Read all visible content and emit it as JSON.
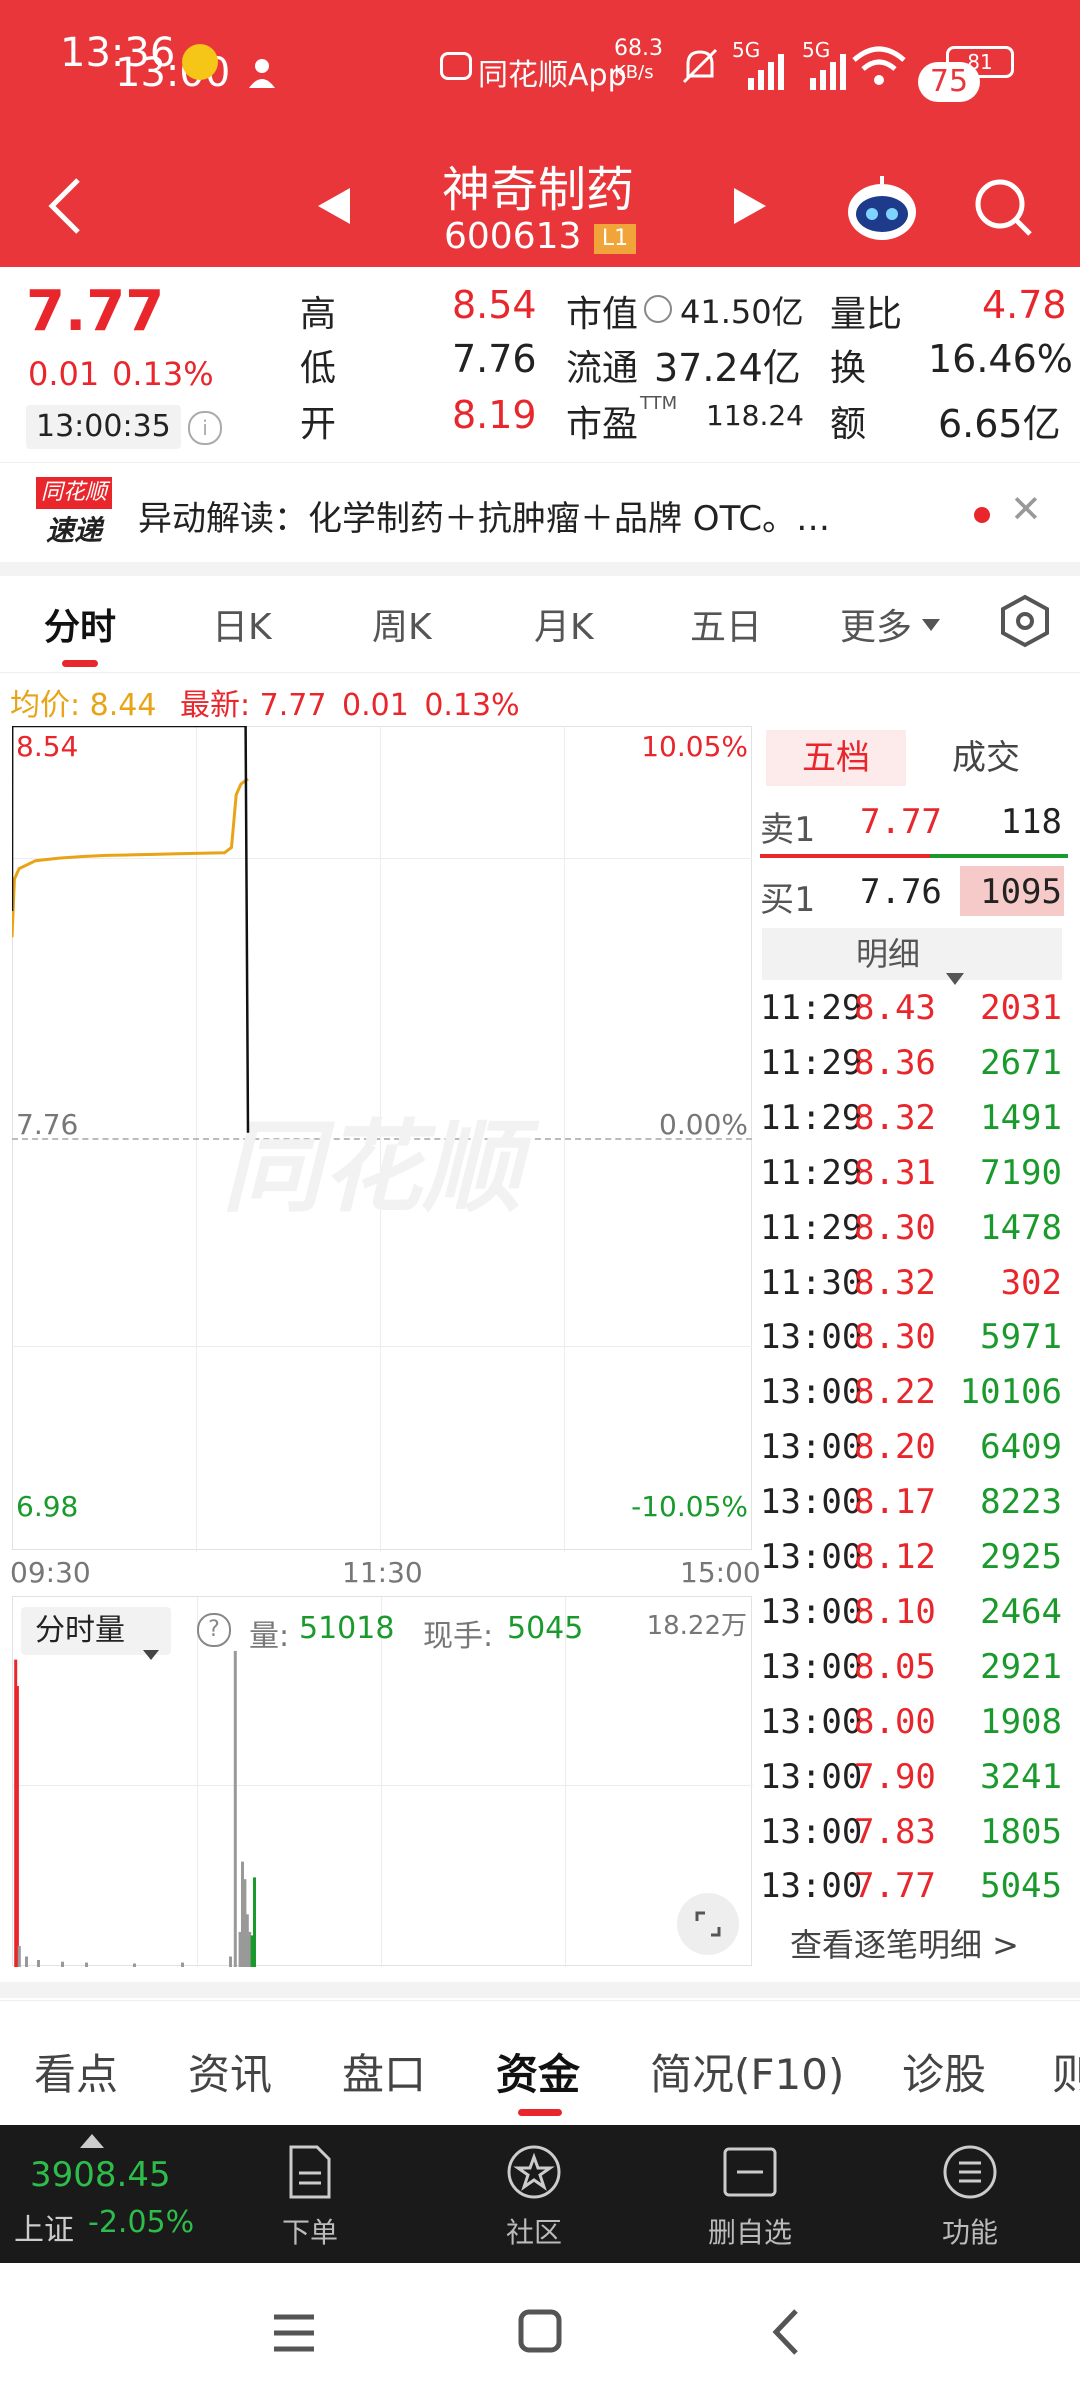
{
  "status_bar": {
    "time": "13:36",
    "time_overlay": "13:00",
    "app_notice": "同花顺App",
    "speed": "68.3",
    "speed_unit": "KB/s",
    "net1": "5G",
    "net2": "5G",
    "battery": "81",
    "overlay_badge": "75"
  },
  "header": {
    "stock_name": "神奇制药",
    "stock_code": "600613",
    "level_badge": "L1"
  },
  "quote": {
    "price": "7.77",
    "change": "0.01",
    "change_pct": "0.13%",
    "time": "13:00:35",
    "high_label": "高",
    "high": "8.54",
    "low_label": "低",
    "low": "7.76",
    "open_label": "开",
    "open": "8.19",
    "mktcap_label": "市值",
    "mktcap": "41.50亿",
    "float_label": "流通",
    "float": "37.24亿",
    "pe_label": "市盈",
    "pe_sup": "TTM",
    "pe": "118.24",
    "vol_ratio_label": "量比",
    "vol_ratio": "4.78",
    "turnover_label": "换",
    "turnover": "16.46%",
    "amount_label": "额",
    "amount": "6.65亿"
  },
  "news": {
    "badge_top": "同花顺",
    "badge_bottom": "速递",
    "text": "异动解读：化学制药＋抗肿瘤＋品牌 OTC。…"
  },
  "tabs": [
    "分时",
    "日K",
    "周K",
    "月K",
    "五日",
    "更多"
  ],
  "chart_info": {
    "avg_label": "均价:",
    "avg": "8.44",
    "latest_label": "最新:",
    "latest": "7.77",
    "change": "0.01",
    "change_pct": "0.13%"
  },
  "watermark": "同花顺",
  "chart_data": {
    "type": "line",
    "title": "",
    "x_ticks": [
      "09:30",
      "11:30",
      "15:00"
    ],
    "y_left_ticks": [
      "8.54",
      "7.76",
      "6.98"
    ],
    "y_right_ticks": [
      "10.05%",
      "0.00%",
      "-10.05%"
    ],
    "ylim": [
      6.98,
      8.54
    ],
    "series": [
      {
        "color": "#e8a317",
        "x_frac": [
          0,
          0.01,
          0.03,
          0.1,
          0.2,
          0.3,
          0.4,
          0.5,
          0.6,
          0.7,
          0.8,
          0.9,
          0.93,
          0.95,
          0.97,
          1.0
        ],
        "values": [
          8.14,
          8.25,
          8.27,
          8.285,
          8.29,
          8.293,
          8.295,
          8.296,
          8.297,
          8.298,
          8.299,
          8.3,
          8.31,
          8.41,
          8.43,
          8.44
        ]
      },
      {
        "color": "#111111",
        "x_frac": [
          0,
          0.001,
          0.02,
          0.5,
          0.99,
          1.0
        ],
        "values": [
          8.19,
          8.54,
          8.54,
          8.54,
          8.54,
          7.77
        ]
      }
    ]
  },
  "volume": {
    "selector": "分时量",
    "vol_label": "量:",
    "vol": "51018",
    "hand_label": "现手:",
    "hand": "5045",
    "max": "18.22万"
  },
  "volume_data": {
    "type": "bar",
    "x_frac": [
      0.005,
      0.012,
      0.02,
      0.05,
      0.1,
      0.2,
      0.3,
      0.5,
      0.7,
      0.9,
      0.92,
      0.94,
      0.95,
      0.96,
      0.97,
      0.98,
      0.99,
      1.0
    ],
    "values": [
      175000,
      160000,
      12000,
      6000,
      4000,
      3000,
      2500,
      2000,
      2500,
      6000,
      180000,
      20000,
      60000,
      50000,
      30000,
      20000,
      18000,
      51018
    ],
    "colors": [
      "#e8262b",
      "#e8262b",
      "#999",
      "#999",
      "#999",
      "#999",
      "#999",
      "#999",
      "#999",
      "#999",
      "#999",
      "#999",
      "#999",
      "#999",
      "#999",
      "#999",
      "#1a9a2c",
      "#1a9a2c"
    ]
  },
  "order_book": {
    "tab_five": "五档",
    "tab_deal": "成交",
    "sell": [
      {
        "label": "卖1",
        "price": "7.77",
        "vol": "118"
      }
    ],
    "buy": [
      {
        "label": "买1",
        "price": "7.76",
        "vol": "1095"
      }
    ],
    "detail_label": "明细",
    "trades": [
      {
        "time": "11:29",
        "price": "8.43",
        "vol": "2031",
        "dir": "sell"
      },
      {
        "time": "11:29",
        "price": "8.36",
        "vol": "2671",
        "dir": "buy"
      },
      {
        "time": "11:29",
        "price": "8.32",
        "vol": "1491",
        "dir": "buy"
      },
      {
        "time": "11:29",
        "price": "8.31",
        "vol": "7190",
        "dir": "buy"
      },
      {
        "time": "11:29",
        "price": "8.30",
        "vol": "1478",
        "dir": "buy"
      },
      {
        "time": "11:30",
        "price": "8.32",
        "vol": "302",
        "dir": "sell"
      },
      {
        "time": "13:00",
        "price": "8.30",
        "vol": "5971",
        "dir": "buy"
      },
      {
        "time": "13:00",
        "price": "8.22",
        "vol": "10106",
        "dir": "buy"
      },
      {
        "time": "13:00",
        "price": "8.20",
        "vol": "6409",
        "dir": "buy"
      },
      {
        "time": "13:00",
        "price": "8.17",
        "vol": "8223",
        "dir": "buy"
      },
      {
        "time": "13:00",
        "price": "8.12",
        "vol": "2925",
        "dir": "buy"
      },
      {
        "time": "13:00",
        "price": "8.10",
        "vol": "2464",
        "dir": "buy"
      },
      {
        "time": "13:00",
        "price": "8.05",
        "vol": "2921",
        "dir": "buy"
      },
      {
        "time": "13:00",
        "price": "8.00",
        "vol": "1908",
        "dir": "buy"
      },
      {
        "time": "13:00",
        "price": "7.90",
        "vol": "3241",
        "dir": "buy"
      },
      {
        "time": "13:00",
        "price": "7.83",
        "vol": "1805",
        "dir": "buy"
      },
      {
        "time": "13:00",
        "price": "7.77",
        "vol": "5045",
        "dir": "buy"
      }
    ],
    "view_all": "查看逐笔明细 >"
  },
  "bottom_tabs": [
    "看点",
    "资讯",
    "盘口",
    "资金",
    "简况(F10)",
    "诊股",
    "则"
  ],
  "bottom_bar": {
    "index_value": "3908.45",
    "index_name": "上证",
    "index_change": "-2.05%",
    "items": [
      "下单",
      "社区",
      "删自选",
      "功能"
    ]
  },
  "colors": {
    "header_red": "#e8363a",
    "up_red": "#e8262b",
    "down_green": "#1a9a2c",
    "avg_line": "#e8a317"
  }
}
